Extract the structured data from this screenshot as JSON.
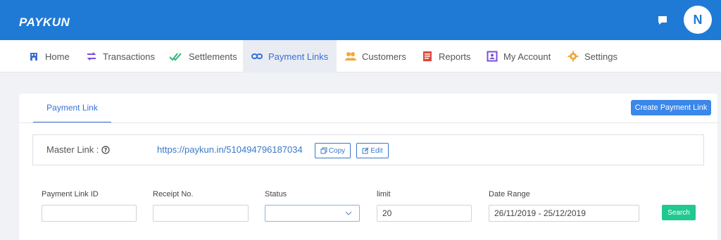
{
  "header": {
    "logo_text": "PAYKUN",
    "avatar_initial": "N"
  },
  "nav": {
    "items": [
      {
        "label": "Home",
        "icon": "home-icon"
      },
      {
        "label": "Transactions",
        "icon": "transactions-icon"
      },
      {
        "label": "Settlements",
        "icon": "settlements-icon"
      },
      {
        "label": "Payment Links",
        "icon": "link-icon",
        "active": true
      },
      {
        "label": "Customers",
        "icon": "customers-icon"
      },
      {
        "label": "Reports",
        "icon": "reports-icon"
      },
      {
        "label": "My Account",
        "icon": "account-icon"
      },
      {
        "label": "Settings",
        "icon": "gear-icon"
      }
    ]
  },
  "page": {
    "tab_label": "Payment Link",
    "create_button": "Create Payment Link",
    "master_link_label": "Master Link :",
    "master_link_url": "https://paykun.in/510494796187034",
    "copy_label": "Copy",
    "edit_label": "Edit"
  },
  "filters": {
    "payment_link_id": {
      "label": "Payment Link ID",
      "value": ""
    },
    "receipt_no": {
      "label": "Receipt No.",
      "value": ""
    },
    "status": {
      "label": "Status",
      "value": ""
    },
    "limit": {
      "label": "limit",
      "value": "20"
    },
    "date_range": {
      "label": "Date Range",
      "value": "26/11/2019 - 25/12/2019"
    },
    "search_label": "Search"
  },
  "colors": {
    "header_bg": "#1f7ad6",
    "accent": "#3a6fd8",
    "search_button": "#1fc98f"
  }
}
